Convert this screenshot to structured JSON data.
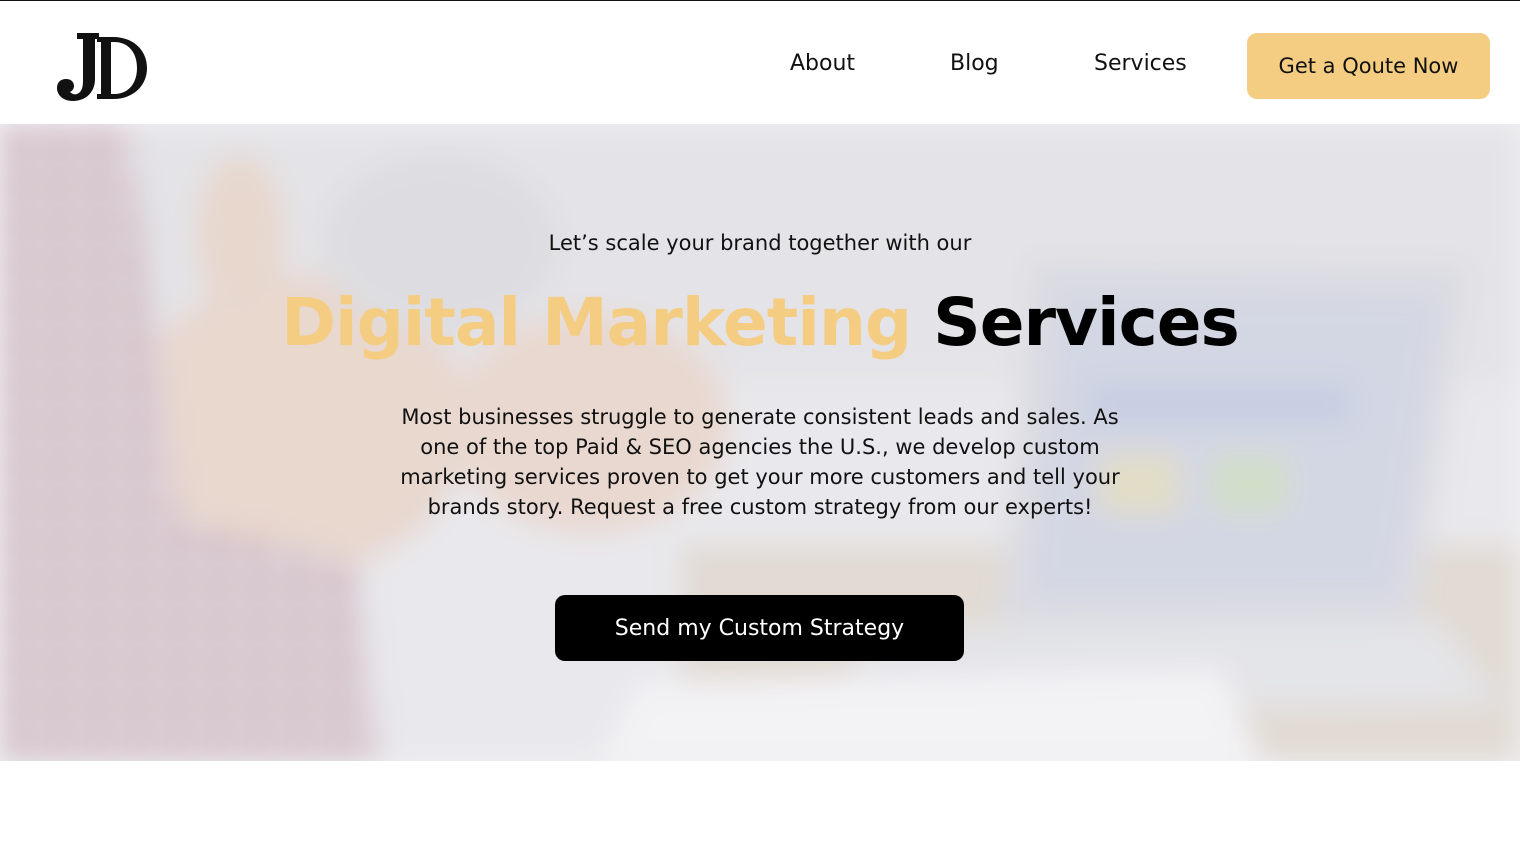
{
  "brand": {
    "logo_text": "JD",
    "accent_color": "#f4cd82",
    "dark_color": "#000000"
  },
  "nav": {
    "items": [
      {
        "label": "About"
      },
      {
        "label": "Blog"
      },
      {
        "label": "Services"
      }
    ],
    "cta_label": "Get a Qoute Now"
  },
  "hero": {
    "kicker": "Let’s scale your brand together with our",
    "title_accent": "Digital Marketing",
    "title_dark": "Services",
    "description": "Most businesses struggle to generate consistent leads and sales. As one of the top Paid & SEO agencies the U.S., we develop custom marketing services proven to get your more customers and tell your brands story. Request a free custom strategy from our experts!",
    "cta_label": "Send my Custom Strategy"
  }
}
